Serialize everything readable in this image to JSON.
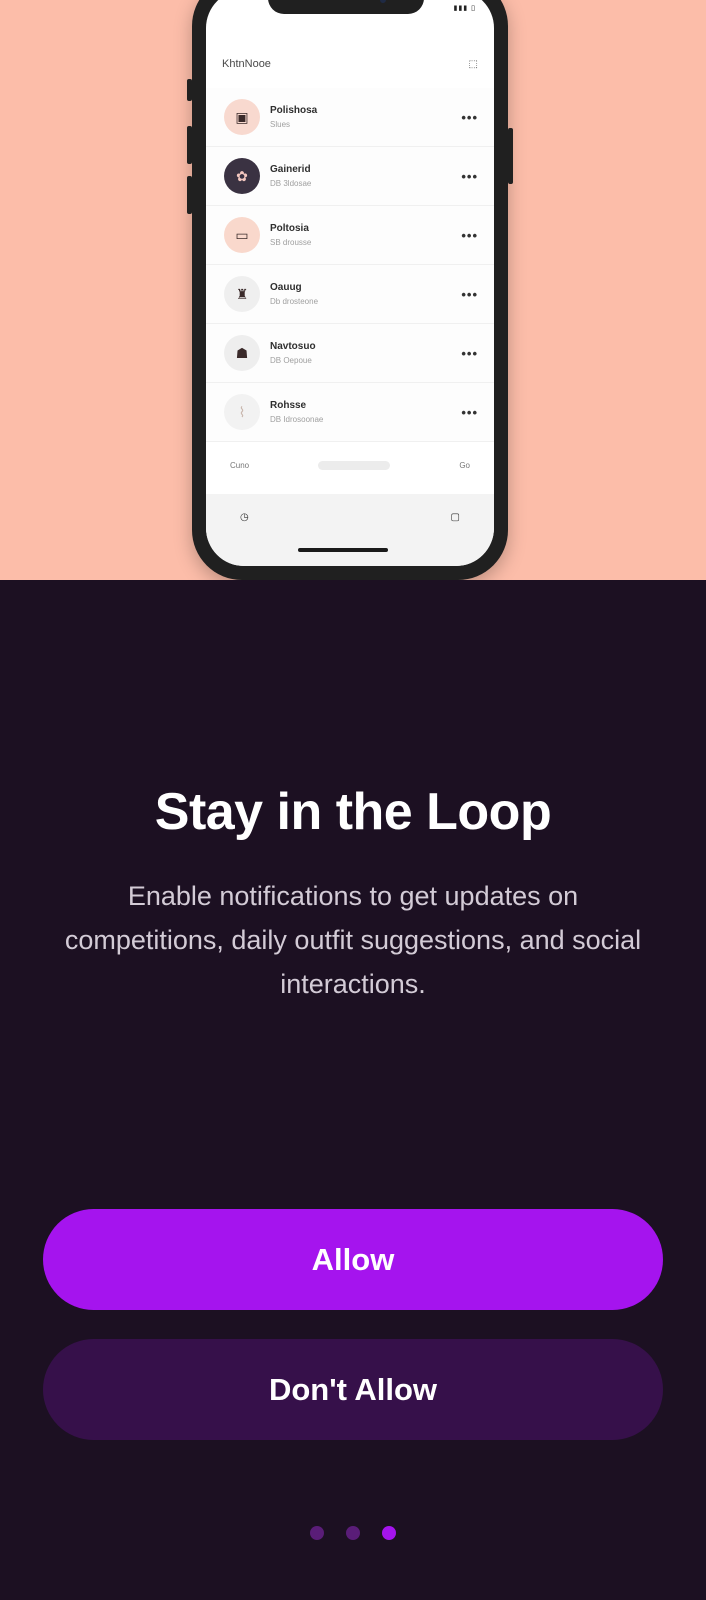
{
  "hero": {
    "app_title": "KhtnNooe",
    "rows": [
      {
        "name": "Polishosa",
        "sub": "Slues",
        "avatar_bg": "#f8d9cf",
        "avatar_glyph": "▣"
      },
      {
        "name": "Gainerid",
        "sub": "DB 3ldosae",
        "avatar_bg": "#3a3242",
        "avatar_glyph": "✿"
      },
      {
        "name": "Poltosia",
        "sub": "SB drousse",
        "avatar_bg": "#f9d8cc",
        "avatar_glyph": "▭"
      },
      {
        "name": "Oauug",
        "sub": "Db drosteone",
        "avatar_bg": "#efefef",
        "avatar_glyph": "♜"
      },
      {
        "name": "Navtosuo",
        "sub": "DB Oepoue",
        "avatar_bg": "#eeeeee",
        "avatar_glyph": "☗"
      },
      {
        "name": "Rohsse",
        "sub": "DB Idrosoonae",
        "avatar_bg": "#f2f2f2",
        "avatar_glyph": "⌇"
      }
    ],
    "more_glyph": "•••",
    "footer_left": "Cuno",
    "footer_right": "Go"
  },
  "content": {
    "title": "Stay in the Loop",
    "subtitle": "Enable notifications to get updates on competitions, daily outfit suggestions, and social interactions."
  },
  "actions": {
    "allow_label": "Allow",
    "dont_allow_label": "Don't Allow"
  },
  "pagination": {
    "total": 3,
    "active_index": 2
  },
  "colors": {
    "background": "#1c1022",
    "hero_background": "#fcbda9",
    "accent": "#a514ee",
    "secondary_button": "#36104a",
    "inactive_dot": "#5a1d78"
  }
}
